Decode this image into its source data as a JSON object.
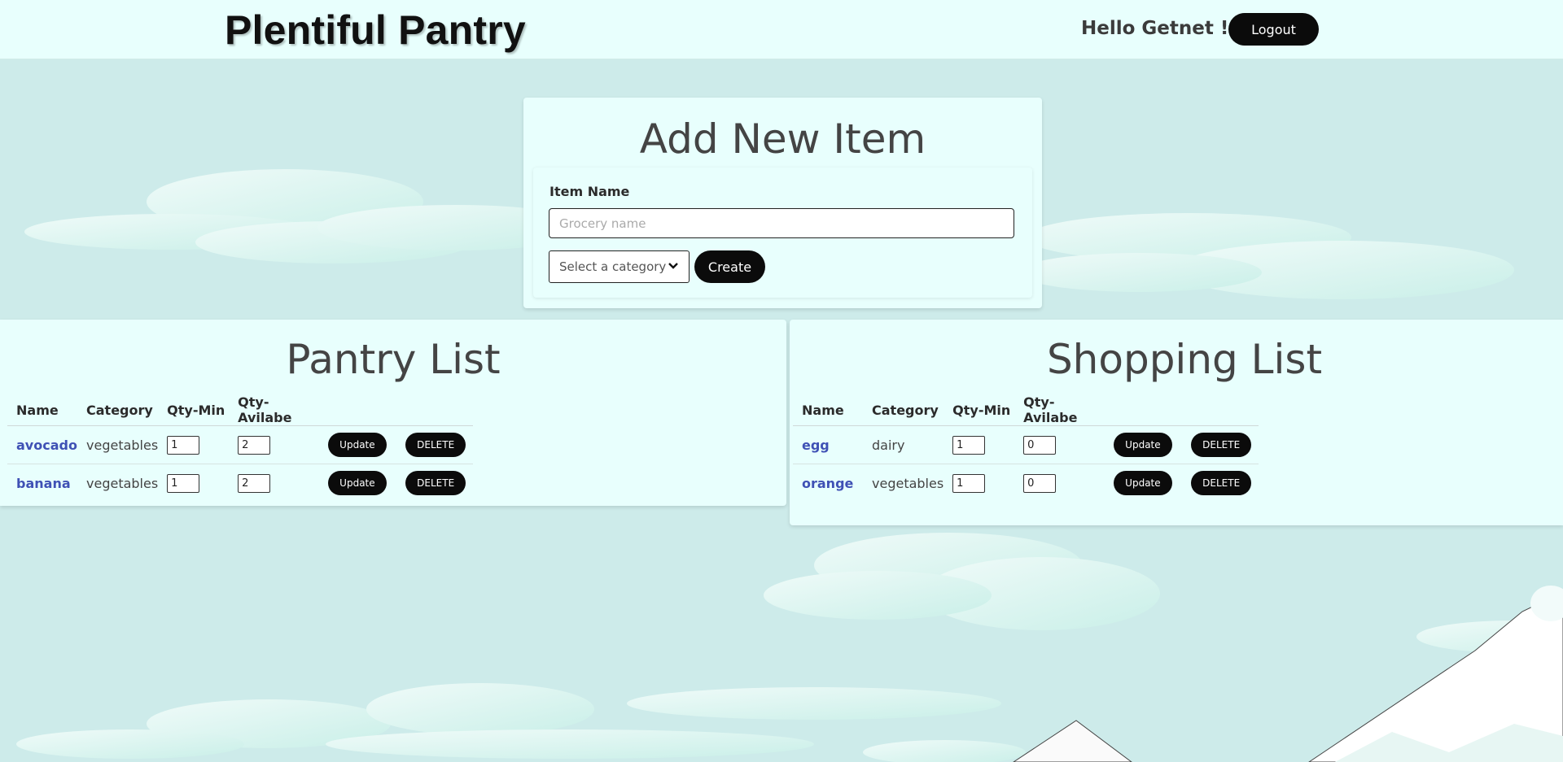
{
  "header": {
    "brand": "Plentiful Pantry",
    "greeting": "Hello Getnet !",
    "logout_label": "Logout"
  },
  "add_item": {
    "title": "Add New Item",
    "item_name_label": "Item Name",
    "item_name_placeholder": "Grocery name",
    "item_name_value": "",
    "category_selected": "Select a category",
    "create_label": "Create"
  },
  "pantry": {
    "title": "Pantry List",
    "columns": [
      "Name",
      "Category",
      "Qty-Min",
      "Qty-Avilabe"
    ],
    "rows": [
      {
        "name": "avocado",
        "category": "vegetables",
        "qty_min": "1",
        "qty_available": "2",
        "update_label": "Update",
        "delete_label": "DELETE"
      },
      {
        "name": "banana",
        "category": "vegetables",
        "qty_min": "1",
        "qty_available": "2",
        "update_label": "Update",
        "delete_label": "DELETE"
      }
    ]
  },
  "shopping": {
    "title": "Shopping List",
    "columns": [
      "Name",
      "Category",
      "Qty-Min",
      "Qty-Avilabe"
    ],
    "rows": [
      {
        "name": "egg",
        "category": "dairy",
        "qty_min": "1",
        "qty_available": "0",
        "update_label": "Update",
        "delete_label": "DELETE"
      },
      {
        "name": "orange",
        "category": "vegetables",
        "qty_min": "1",
        "qty_available": "0",
        "update_label": "Update",
        "delete_label": "DELETE"
      }
    ]
  },
  "colors": {
    "background": "#cdebea",
    "card": "#e8fffd",
    "button": "#0b0b0b",
    "link": "#3f51b5"
  }
}
